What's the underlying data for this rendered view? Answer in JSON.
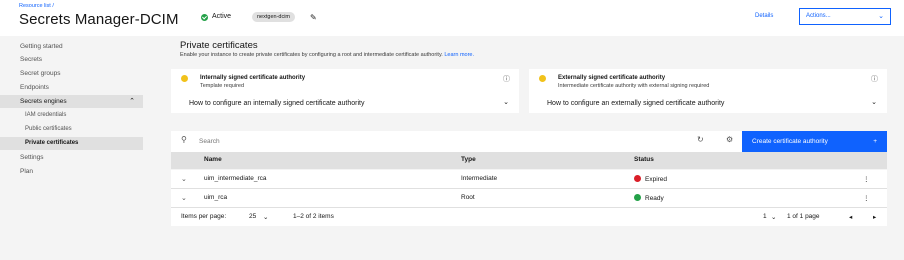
{
  "header": {
    "breadcrumb": "Resource list",
    "breadcrumb_sep": "/",
    "title": "Secrets Manager-DCIM",
    "status": "Active",
    "tag": "nextgen-dcim",
    "details": "Details",
    "actions": "Actions..."
  },
  "sidebar": {
    "items": [
      {
        "label": "Getting started"
      },
      {
        "label": "Secrets"
      },
      {
        "label": "Secret groups"
      },
      {
        "label": "Endpoints"
      },
      {
        "label": "Secrets engines"
      },
      {
        "label": "IAM credentials"
      },
      {
        "label": "Public certificates"
      },
      {
        "label": "Private certificates"
      },
      {
        "label": "Settings"
      },
      {
        "label": "Plan"
      }
    ]
  },
  "main": {
    "title": "Private certificates",
    "description": "Enable your instance to create private certificates by configuring a root and intermediate certificate authority.",
    "learn_more": "Learn more.",
    "tiles": [
      {
        "title": "Internally signed certificate authority",
        "subtitle": "Template required",
        "how_to": "How to configure an internally signed certificate authority"
      },
      {
        "title": "Externally signed certificate authority",
        "subtitle": "Intermediate certificate authority with external signing required",
        "how_to": "How to configure an externally signed certificate authority"
      }
    ],
    "search_placeholder": "Search",
    "create_button": "Create certificate authority",
    "table": {
      "columns": [
        "Name",
        "Type",
        "Status"
      ],
      "rows": [
        {
          "name": "uim_intermediate_rca",
          "type": "Intermediate",
          "status": "Expired",
          "status_color": "#da1e28"
        },
        {
          "name": "uim_rca",
          "type": "Root",
          "status": "Ready",
          "status_color": "#24a148"
        }
      ]
    },
    "pagination": {
      "items_per_page_label": "Items per page:",
      "items_per_page": "25",
      "range": "1–2 of 2 items",
      "page": "1",
      "of_pages": "1 of 1 page"
    }
  },
  "colors": {
    "accent": "#0f62fe",
    "active": "#24a148",
    "warning": "#f1c21b"
  }
}
